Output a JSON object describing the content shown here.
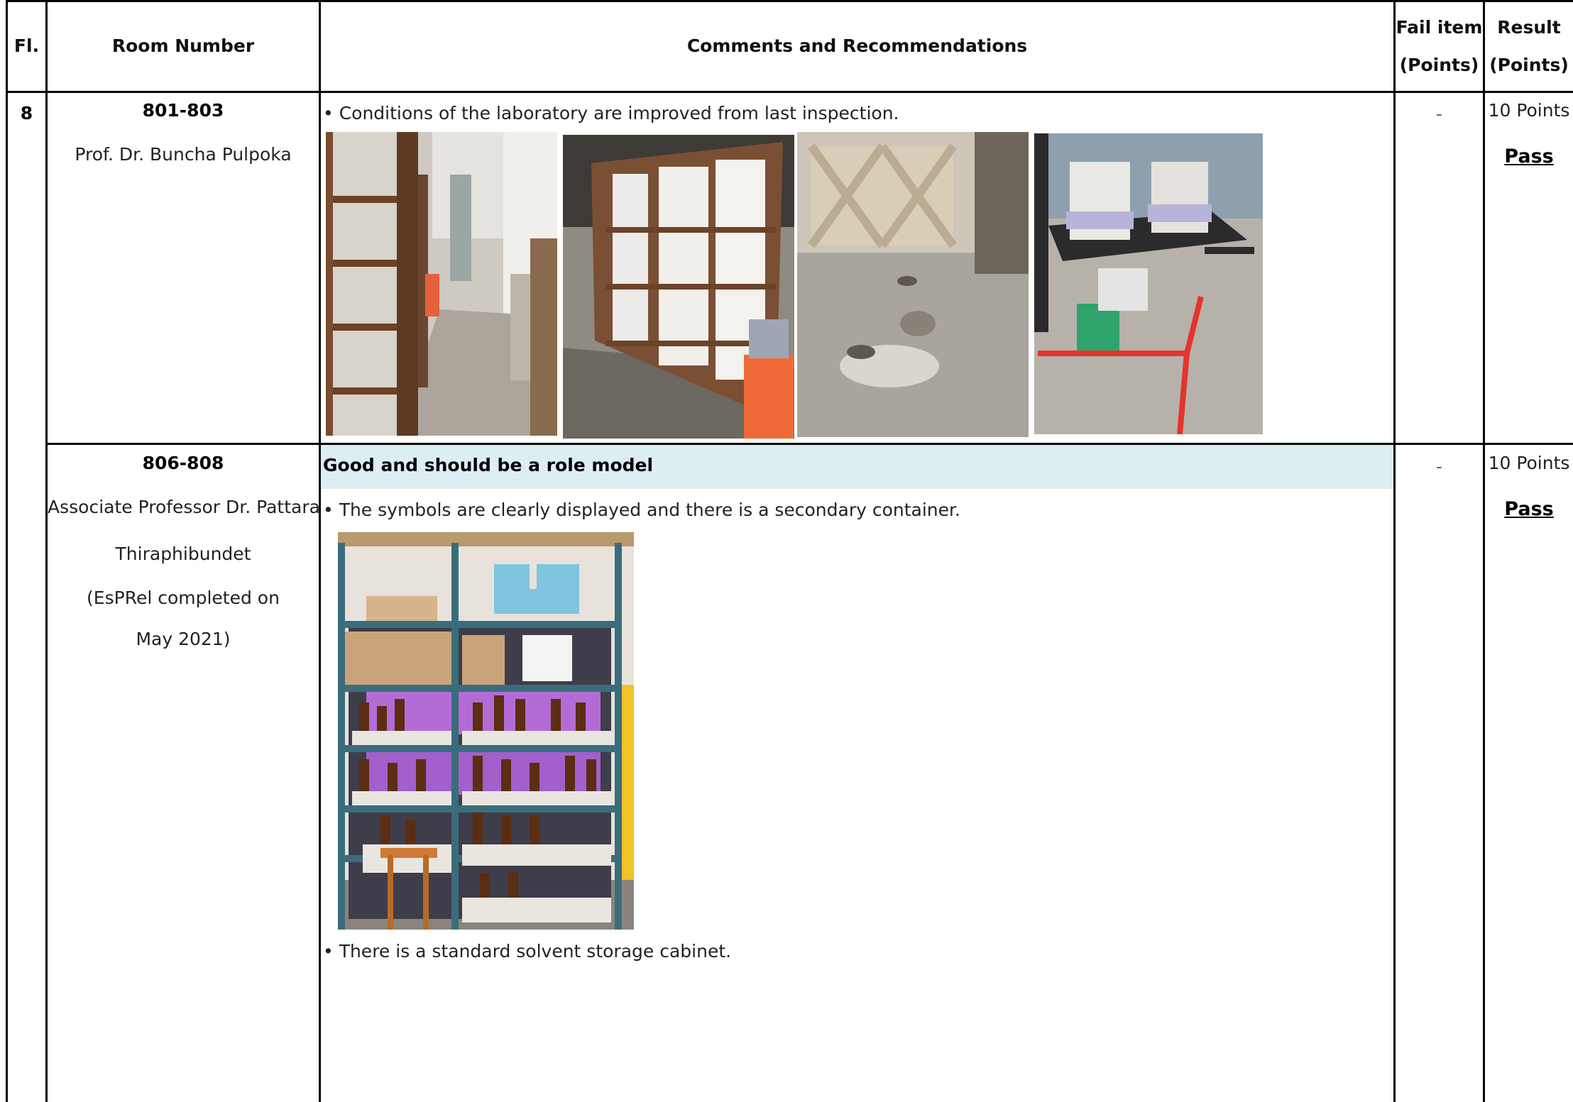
{
  "header": {
    "fl": "Fl.",
    "room_number": "Room Number",
    "comments": "Comments and Recommendations",
    "fail_item_line1": "Fail item",
    "fail_item_line2": "(Points)",
    "result_line1": "Result",
    "result_line2": "(Points)"
  },
  "rows": [
    {
      "floor": "8",
      "room": "801-803",
      "person": "Prof. Dr. Buncha Pulpoka",
      "comment": "• Conditions of the laboratory are improved from last inspection.",
      "fail": "-",
      "points": "10 Points",
      "result": "Pass",
      "photos": [
        "wooden-shelves-corridor-photo",
        "empty-wooden-bookshelf-photo",
        "balcony-floor-drain-photo",
        "chemical-waste-table-photo"
      ]
    },
    {
      "room": "806-808",
      "person_line1": "Associate Professor Dr. Pattara",
      "person_line2": "Thiraphibundet",
      "person_line3": "(EsPRel completed on",
      "person_line4": "May 2021)",
      "highlight": "Good and should be a role model",
      "comment1": "• The symbols are clearly displayed and there is a secondary container.",
      "comment2": "• There is a standard solvent storage cabinet.",
      "fail": "-",
      "points": "10 Points",
      "result": "Pass",
      "photos": [
        "chemical-storage-shelf-photo"
      ]
    }
  ]
}
